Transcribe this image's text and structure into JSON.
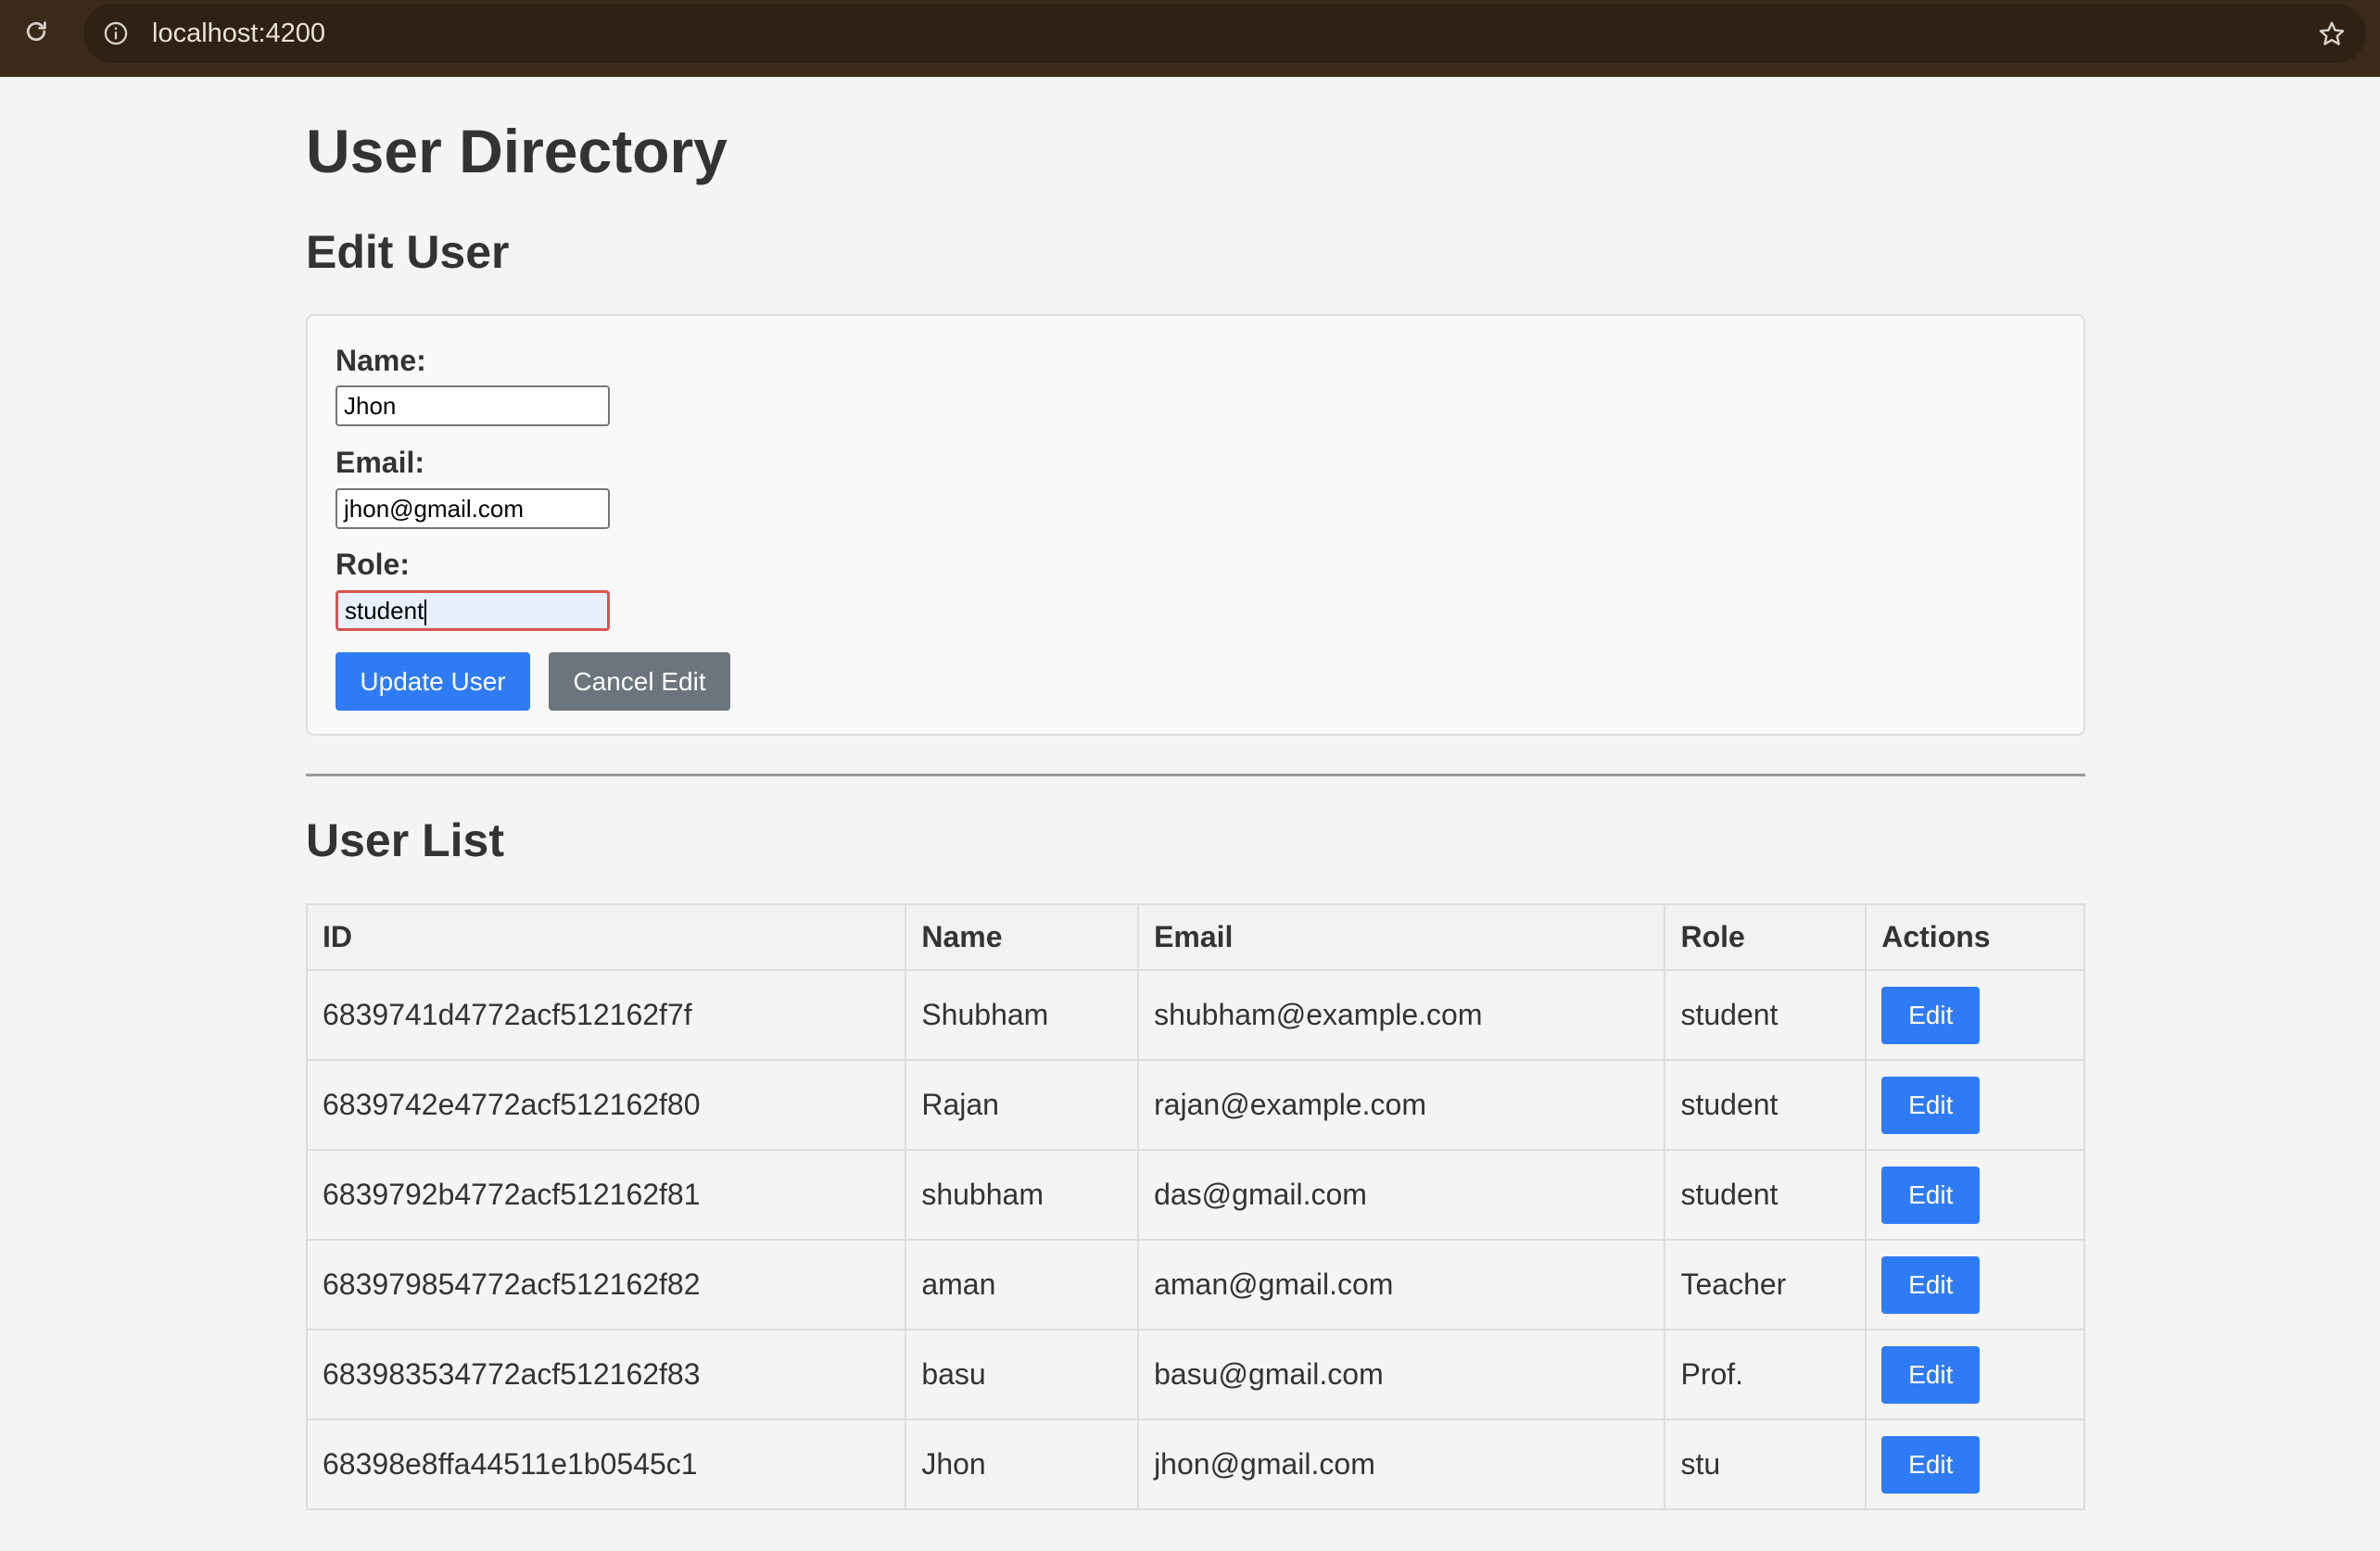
{
  "browser": {
    "url": "localhost:4200"
  },
  "page": {
    "title": "User Directory",
    "edit_section_title": "Edit User",
    "list_section_title": "User List"
  },
  "form": {
    "name_label": "Name:",
    "name_value": "Jhon",
    "email_label": "Email:",
    "email_value": "jhon@gmail.com",
    "role_label": "Role:",
    "role_value": "student",
    "update_button": "Update User",
    "cancel_button": "Cancel Edit"
  },
  "table": {
    "headers": [
      "ID",
      "Name",
      "Email",
      "Role",
      "Actions"
    ],
    "action_label": "Edit",
    "rows": [
      {
        "id": "6839741d4772acf512162f7f",
        "name": "Shubham",
        "email": "shubham@example.com",
        "role": "student"
      },
      {
        "id": "6839742e4772acf512162f80",
        "name": "Rajan",
        "email": "rajan@example.com",
        "role": "student"
      },
      {
        "id": "6839792b4772acf512162f81",
        "name": "shubham",
        "email": "das@gmail.com",
        "role": "student"
      },
      {
        "id": "683979854772acf512162f82",
        "name": "aman",
        "email": "aman@gmail.com",
        "role": "Teacher"
      },
      {
        "id": "683983534772acf512162f83",
        "name": "basu",
        "email": "basu@gmail.com",
        "role": "Prof."
      },
      {
        "id": "68398e8ffa44511e1b0545c1",
        "name": "Jhon",
        "email": "jhon@gmail.com",
        "role": "stu"
      }
    ]
  },
  "icons": {
    "reload": "reload-icon",
    "info": "info-icon",
    "bookmark": "star-icon"
  },
  "colors": {
    "primary": "#2f7bf5",
    "secondary": "#6c757d",
    "focus_border": "#d9534f"
  }
}
